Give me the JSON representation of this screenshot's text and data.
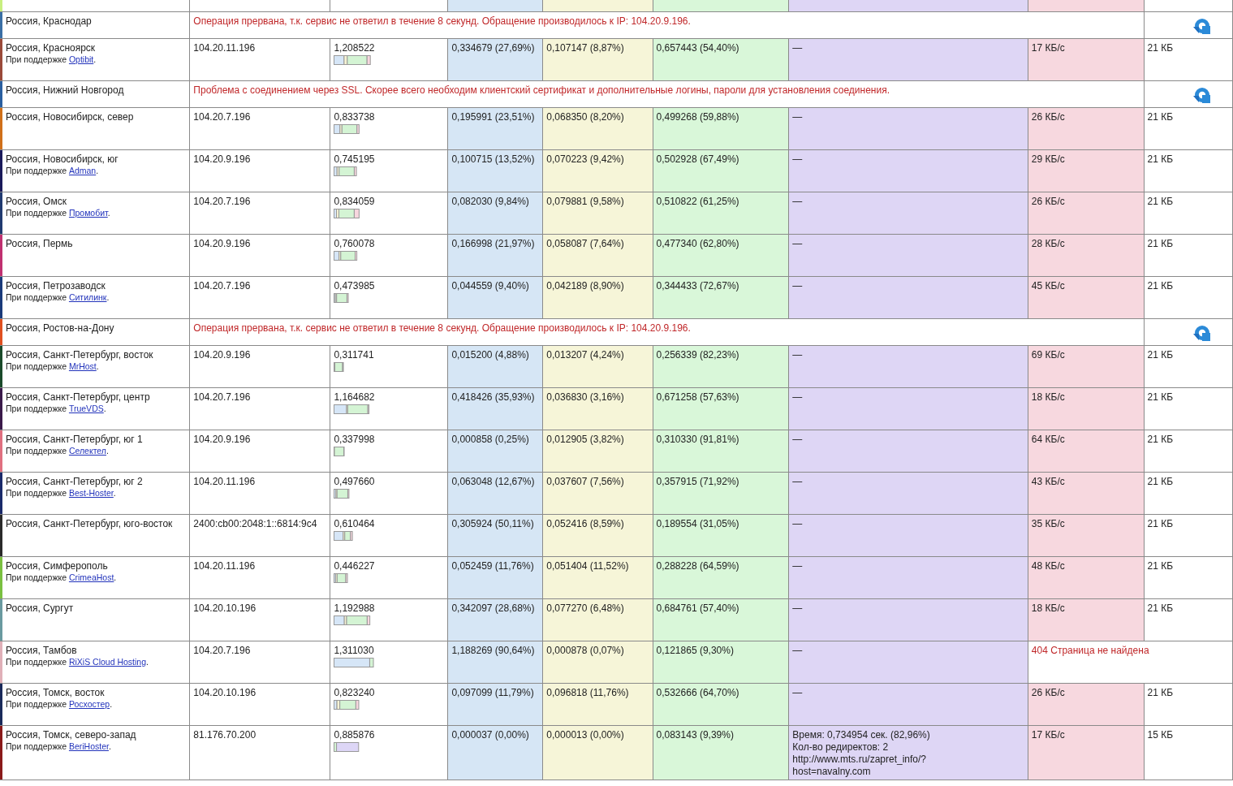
{
  "rows": [
    {
      "kind": "error",
      "location": "Россия, Краснодар",
      "color": "#3a6fa5",
      "error": "Операция прервана, т.к. сервис не ответил в течение 8 секунд. Обращение производилось к IP: 104.20.9.196."
    },
    {
      "kind": "result",
      "location": "Россия, Красноярск",
      "color": "#9a4a3a",
      "sponsor_prefix": "При поддержке",
      "sponsor": "Optibit",
      "sponsor_suffix": ".",
      "ip": "104.20.11.196",
      "total": "1,208522",
      "connect": "0,334679 (27,69%)",
      "wait": "0,107147 (8,87%)",
      "download": "0,657443 (54,40%)",
      "redirect": [
        "—"
      ],
      "speed": "17 КБ/с",
      "size": "21 КБ"
    },
    {
      "kind": "error",
      "location": "Россия, Нижний Новгород",
      "color": "#2a5fa0",
      "error": "Проблема с соединением через SSL. Скорее всего необходим клиентский сертификат и дополнительные логины, пароли для установления соединения."
    },
    {
      "kind": "result",
      "location": "Россия, Новосибирск, север",
      "color": "#d0701a",
      "ip": "104.20.7.196",
      "total": "0,833738",
      "connect": "0,195991 (23,51%)",
      "wait": "0,068350 (8,20%)",
      "download": "0,499268 (59,88%)",
      "redirect": [
        "—"
      ],
      "speed": "26 КБ/с",
      "size": "21 КБ"
    },
    {
      "kind": "result",
      "location": "Россия, Новосибирск, юг",
      "color": "#1a1a5a",
      "sponsor_prefix": "При поддержке",
      "sponsor": "Adman",
      "sponsor_suffix": ".",
      "ip": "104.20.9.196",
      "total": "0,745195",
      "connect": "0,100715 (13,52%)",
      "wait": "0,070223 (9,42%)",
      "download": "0,502928 (67,49%)",
      "redirect": [
        "—"
      ],
      "speed": "29 КБ/с",
      "size": "21 КБ"
    },
    {
      "kind": "result",
      "location": "Россия, Омск",
      "color": "#203a70",
      "sponsor_prefix": "При поддержке",
      "sponsor": "Промобит",
      "sponsor_suffix": ".",
      "ip": "104.20.7.196",
      "total": "0,834059",
      "connect": "0,082030 (9,84%)",
      "wait": "0,079881 (9,58%)",
      "download": "0,510822 (61,25%)",
      "redirect": [
        "—"
      ],
      "speed": "26 КБ/с",
      "size": "21 КБ"
    },
    {
      "kind": "result",
      "location": "Россия, Пермь",
      "color": "#c03070",
      "ip": "104.20.9.196",
      "total": "0,760078",
      "connect": "0,166998 (21,97%)",
      "wait": "0,058087 (7,64%)",
      "download": "0,477340 (62,80%)",
      "redirect": [
        "—"
      ],
      "speed": "28 КБ/с",
      "size": "21 КБ"
    },
    {
      "kind": "result",
      "location": "Россия, Петрозаводск",
      "color": "#1a3a7a",
      "sponsor_prefix": "При поддержке",
      "sponsor": "Ситилинк",
      "sponsor_suffix": ".",
      "ip": "104.20.7.196",
      "total": "0,473985",
      "connect": "0,044559 (9,40%)",
      "wait": "0,042189 (8,90%)",
      "download": "0,344433 (72,67%)",
      "redirect": [
        "—"
      ],
      "speed": "45 КБ/с",
      "size": "21 КБ"
    },
    {
      "kind": "error",
      "location": "Россия, Ростов-на-Дону",
      "color": "#e05020",
      "error": "Операция прервана, т.к. сервис не ответил в течение 8 секунд. Обращение производилось к IP: 104.20.9.196."
    },
    {
      "kind": "result",
      "location": "Россия, Санкт-Петербург, восток",
      "color": "#1a4a2a",
      "sponsor_prefix": "При поддержке",
      "sponsor": "MrHost",
      "sponsor_suffix": ".",
      "ip": "104.20.9.196",
      "total": "0,311741",
      "connect": "0,015200 (4,88%)",
      "wait": "0,013207 (4,24%)",
      "download": "0,256339 (82,23%)",
      "redirect": [
        "—"
      ],
      "speed": "69 КБ/с",
      "size": "21 КБ"
    },
    {
      "kind": "result",
      "location": "Россия, Санкт-Петербург, центр",
      "color": "#3a1a4a",
      "sponsor_prefix": "При поддержке",
      "sponsor": "TrueVDS",
      "sponsor_suffix": ".",
      "ip": "104.20.7.196",
      "total": "1,164682",
      "connect": "0,418426 (35,93%)",
      "wait": "0,036830 (3,16%)",
      "download": "0,671258 (57,63%)",
      "redirect": [
        "—"
      ],
      "speed": "18 КБ/с",
      "size": "21 КБ"
    },
    {
      "kind": "result",
      "location": "Россия, Санкт-Петербург, юг 1",
      "color": "#e07080",
      "sponsor_prefix": "При поддержке",
      "sponsor": "Селектел",
      "sponsor_suffix": ".",
      "ip": "104.20.9.196",
      "total": "0,337998",
      "connect": "0,000858 (0,25%)",
      "wait": "0,012905 (3,82%)",
      "download": "0,310330 (91,81%)",
      "redirect": [
        "—"
      ],
      "speed": "64 КБ/с",
      "size": "21 КБ"
    },
    {
      "kind": "result",
      "location": "Россия, Санкт-Петербург, юг 2",
      "color": "#1a2a6a",
      "sponsor_prefix": "При поддержке",
      "sponsor": "Best-Hoster",
      "sponsor_suffix": ".",
      "ip": "104.20.11.196",
      "total": "0,497660",
      "connect": "0,063048 (12,67%)",
      "wait": "0,037607 (7,56%)",
      "download": "0,357915 (71,92%)",
      "redirect": [
        "—"
      ],
      "speed": "43 КБ/с",
      "size": "21 КБ"
    },
    {
      "kind": "result",
      "location": "Россия, Санкт-Петербург, юго-восток",
      "color": "#2a2a2a",
      "ip": "2400:cb00:2048:1::6814:9c4",
      "total": "0,610464",
      "connect": "0,305924 (50,11%)",
      "wait": "0,052416 (8,59%)",
      "download": "0,189554 (31,05%)",
      "redirect": [
        "—"
      ],
      "speed": "35 КБ/с",
      "size": "21 КБ"
    },
    {
      "kind": "result",
      "location": "Россия, Симферополь",
      "color": "#7ac040",
      "sponsor_prefix": "При поддержке",
      "sponsor": "CrimeaHost",
      "sponsor_suffix": ".",
      "ip": "104.20.11.196",
      "total": "0,446227",
      "connect": "0,052459 (11,76%)",
      "wait": "0,051404 (11,52%)",
      "download": "0,288228 (64,59%)",
      "redirect": [
        "—"
      ],
      "speed": "48 КБ/с",
      "size": "21 КБ"
    },
    {
      "kind": "result",
      "location": "Россия, Сургут",
      "color": "#6a9aa0",
      "ip": "104.20.10.196",
      "total": "1,192988",
      "connect": "0,342097 (28,68%)",
      "wait": "0,077270 (6,48%)",
      "download": "0,684761 (57,40%)",
      "redirect": [
        "—"
      ],
      "speed": "18 КБ/с",
      "size": "21 КБ"
    },
    {
      "kind": "result",
      "location": "Россия, Тамбов",
      "color": "#e0b0b8",
      "sponsor_prefix": "При поддержке",
      "sponsor": "RiXiS Cloud Hosting",
      "sponsor_suffix": ".",
      "ip": "104.20.7.196",
      "total": "1,311030",
      "connect": "1,188269 (90,64%)",
      "wait": "0,000878 (0,07%)",
      "download": "0,121865 (9,30%)",
      "redirect": [
        "—"
      ],
      "speed_error": "404 Страница не найдена"
    },
    {
      "kind": "result",
      "location": "Россия, Томск, восток",
      "color": "#1a2a5a",
      "sponsor_prefix": "При поддержке",
      "sponsor": "Росхостер",
      "sponsor_suffix": ".",
      "ip": "104.20.10.196",
      "total": "0,823240",
      "connect": "0,097099 (11,79%)",
      "wait": "0,096818 (11,76%)",
      "download": "0,532666 (64,70%)",
      "redirect": [
        "—"
      ],
      "speed": "26 КБ/с",
      "size": "21 КБ"
    },
    {
      "kind": "result",
      "location": "Россия, Томск, северо-запад",
      "color": "#8a1a1a",
      "sponsor_prefix": "При поддержке",
      "sponsor": "BeriHoster",
      "sponsor_suffix": ".",
      "ip": "81.176.70.200",
      "total": "0,885876",
      "connect": "0,000037 (0,00%)",
      "wait": "0,000013 (0,00%)",
      "download": "0,083143 (9,39%)",
      "redirect": [
        "Время: 0,734954 сек. (82,96%)",
        "Кол-во редиректов: 2",
        "http://www.mts.ru/zapret_info/?",
        "host=navalny.com"
      ],
      "speed": "17 КБ/с",
      "size": "15 КБ"
    }
  ]
}
